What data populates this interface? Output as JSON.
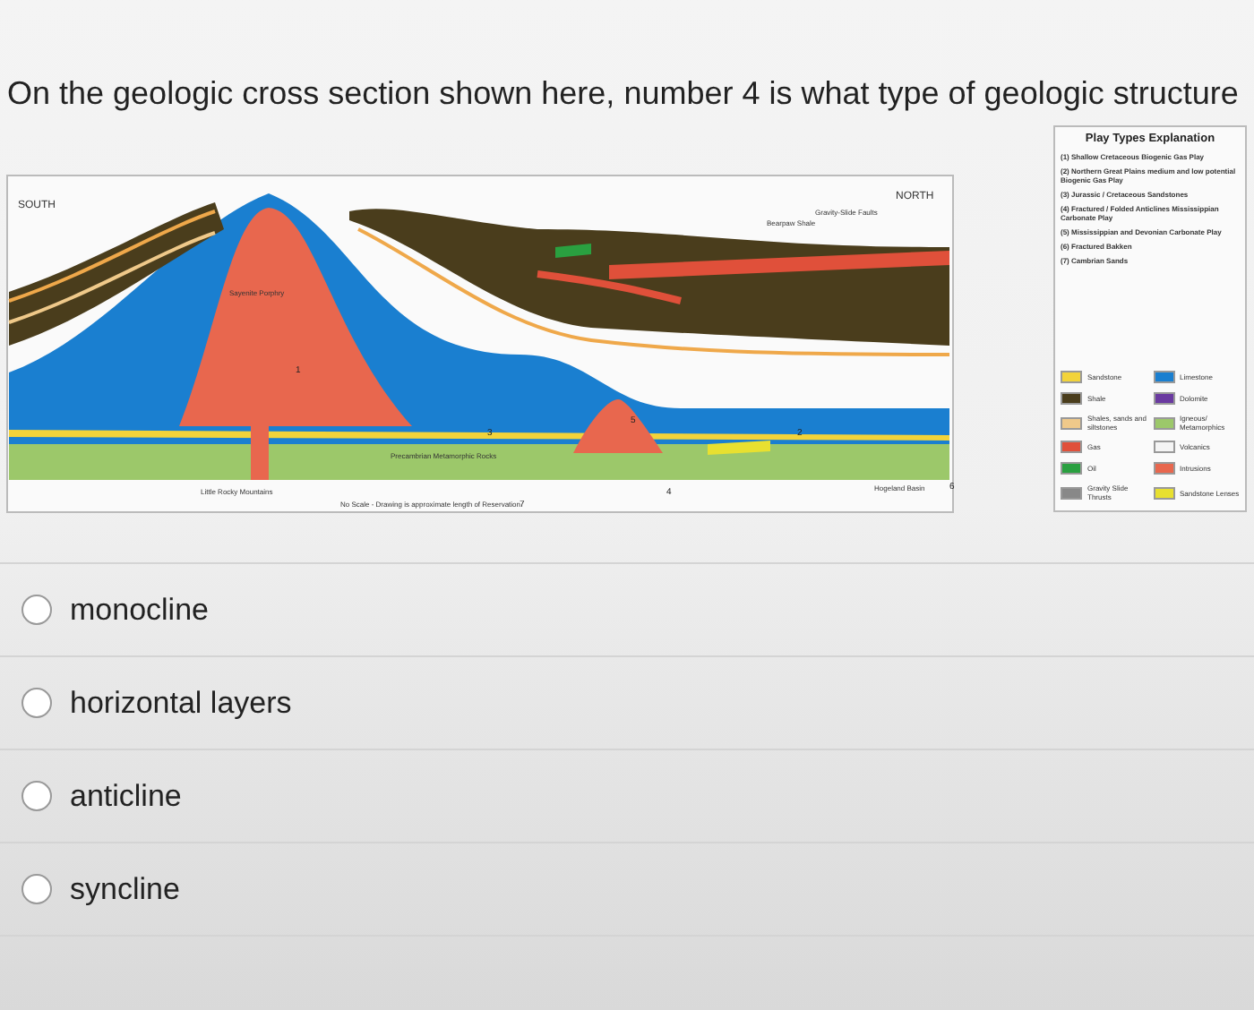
{
  "question": "On the geologic cross section shown here, number 4 is what type of geologic structure",
  "figure": {
    "south_label": "SOUTH",
    "north_label": "NORTH",
    "legend_title": "Play Types Explanation",
    "plays": [
      "(1) Shallow Cretaceous Biogenic Gas Play",
      "(2) Northern Great Plains medium and low potential Biogenic Gas Play",
      "(3) Jurassic / Cretaceous Sandstones",
      "(4) Fractured / Folded Anticlines Mississippian Carbonate Play",
      "(5) Mississippian and Devonian Carbonate Play",
      "(6) Fractured Bakken",
      "(7) Cambrian Sands"
    ],
    "rock_types": [
      {
        "label": "Sandstone",
        "color": "#f2d33a"
      },
      {
        "label": "Limestone",
        "color": "#1a7fd0"
      },
      {
        "label": "Shale",
        "color": "#4a3d1c"
      },
      {
        "label": "Dolomite",
        "color": "#6a3aa0"
      },
      {
        "label": "Shales, sands and siltstones",
        "color": "#efc98a"
      },
      {
        "label": "Igneous/ Metamorphics",
        "color": "#9cc86a"
      },
      {
        "label": "Gas",
        "color": "#e0503a"
      },
      {
        "label": "Volcanics",
        "color": "#f4f4f4"
      },
      {
        "label": "Oil",
        "color": "#2aa040"
      },
      {
        "label": "Intrusions",
        "color": "#e8674e"
      },
      {
        "label": "Gravity Slide Thrusts",
        "color": "#888888"
      },
      {
        "label": "Sandstone Lenses",
        "color": "#e8e030"
      }
    ],
    "labels": {
      "intrusion": "Sayenite Porphry",
      "basement": "Precambrian Metamorphic Rocks",
      "mountains": "Little Rocky Mountains",
      "basin": "Hogeland Basin",
      "faults": "Gravity-Slide Faults",
      "shale": "Bearpaw Shale",
      "scale_note": "No Scale - Drawing is approximate length of Reservation"
    },
    "numbers": [
      "1",
      "3",
      "4",
      "5",
      "6",
      "7",
      "2"
    ]
  },
  "options": [
    {
      "label": "monocline",
      "selected": false
    },
    {
      "label": "horizontal layers",
      "selected": false
    },
    {
      "label": "anticline",
      "selected": false
    },
    {
      "label": "syncline",
      "selected": false
    }
  ]
}
